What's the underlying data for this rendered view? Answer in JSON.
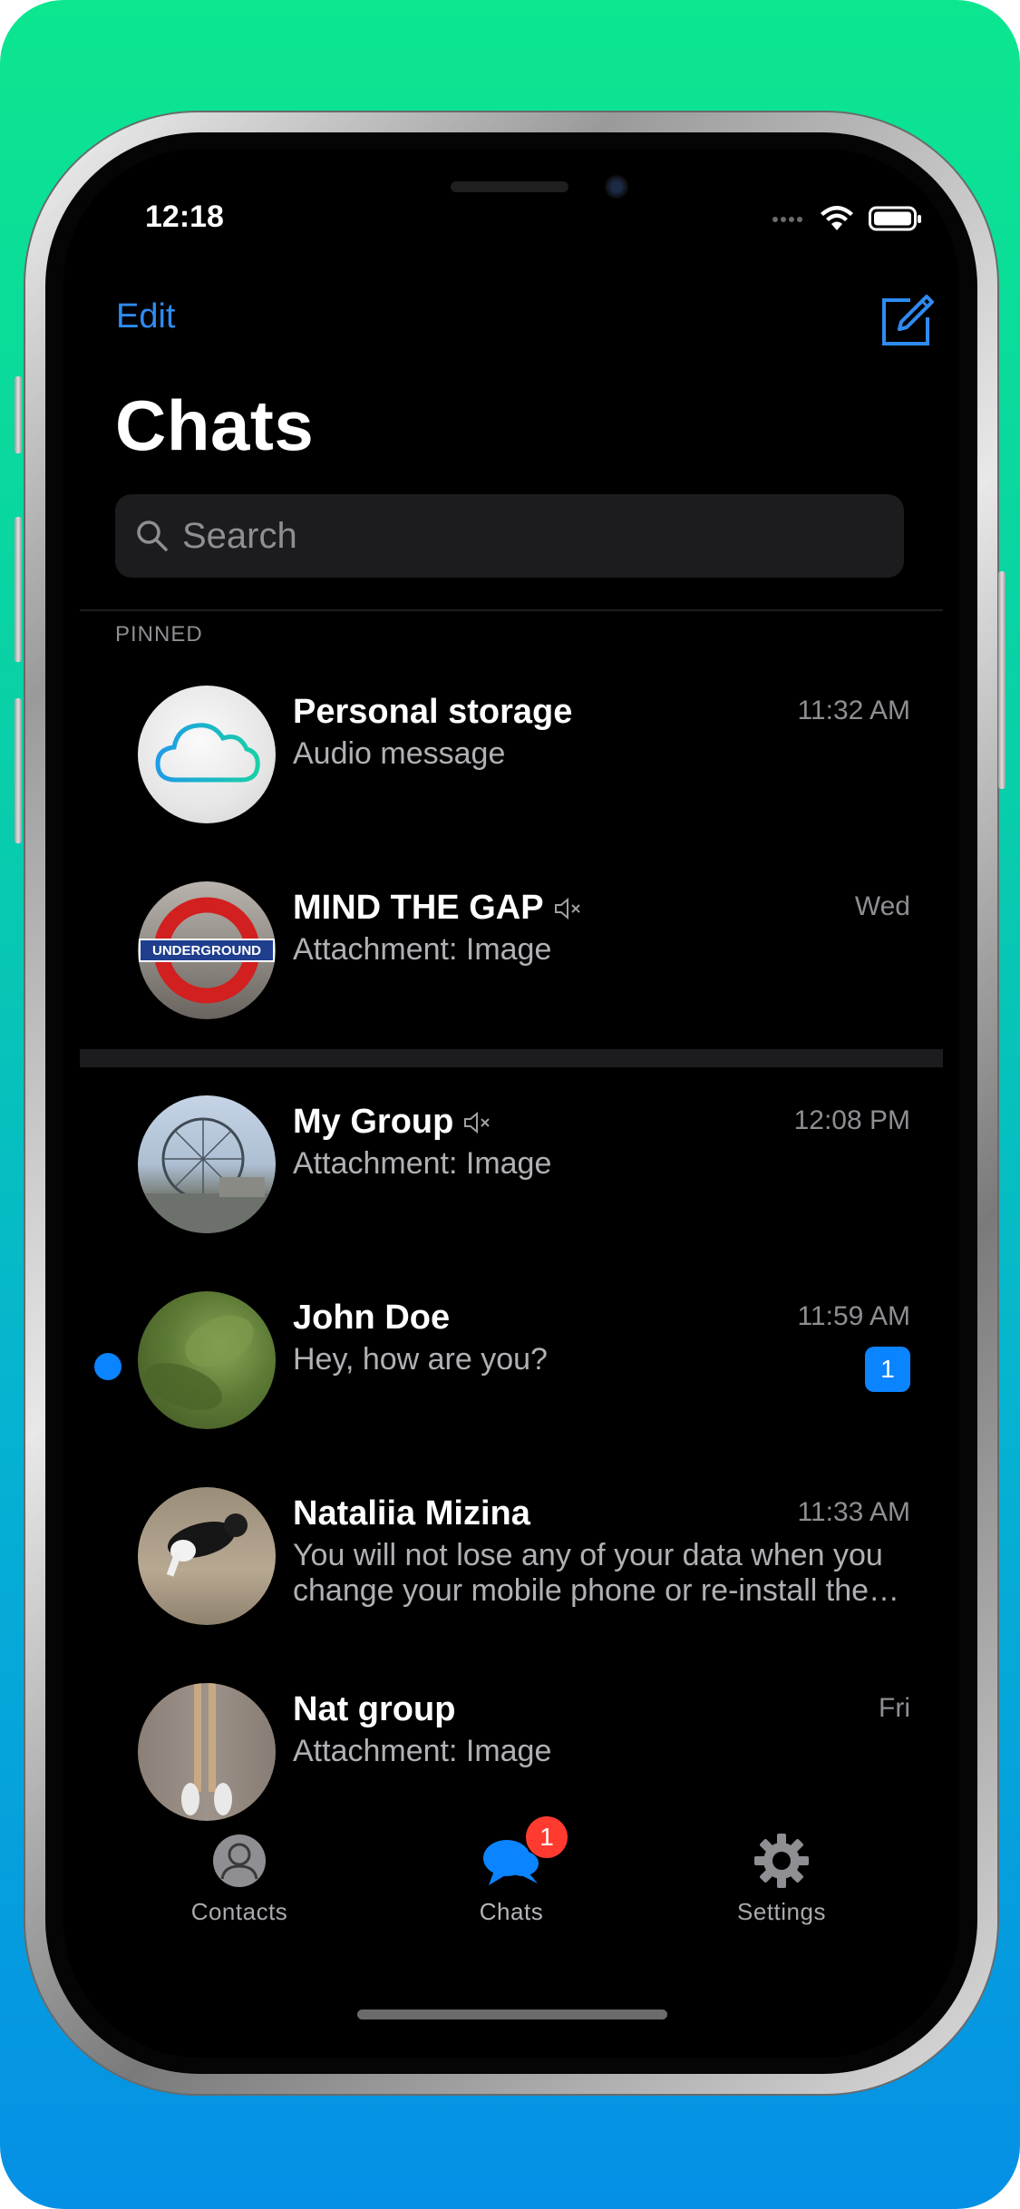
{
  "status": {
    "time": "12:18"
  },
  "header": {
    "edit_label": "Edit",
    "title": "Chats",
    "compose_icon": "compose-icon"
  },
  "search": {
    "placeholder": "Search"
  },
  "sections": {
    "pinned_label": "PINNED"
  },
  "pinned_chats": [
    {
      "name": "Personal storage",
      "message": "Audio message",
      "time": "11:32 AM",
      "muted": false,
      "avatar": "cloud-icon"
    },
    {
      "name": "MIND THE GAP",
      "message": "Attachment: Image",
      "time": "Wed",
      "muted": true,
      "avatar": "underground-roundel"
    }
  ],
  "chats": [
    {
      "name": "My Group",
      "message": "Attachment: Image",
      "time": "12:08 PM",
      "muted": true,
      "avatar": "ferris-wheel-photo"
    },
    {
      "name": "John Doe",
      "message": "Hey, how are you?",
      "time": "11:59 AM",
      "unread": true,
      "unread_count": "1",
      "avatar": "leaf-photo"
    },
    {
      "name": "Nataliia Mizina",
      "message": "You will not lose any of your data when you change your mobile phone or re-install the app",
      "time": "11:33 AM",
      "avatar": "cat-photo"
    },
    {
      "name": "Nat group",
      "message": "Attachment: Image",
      "time": "Fri",
      "avatar": "shoes-photo"
    }
  ],
  "tabbar": {
    "tabs": [
      {
        "label": "Contacts",
        "icon": "person-icon",
        "active": false
      },
      {
        "label": "Chats",
        "icon": "chat-bubbles-icon",
        "active": true,
        "badge": "1"
      },
      {
        "label": "Settings",
        "icon": "gear-icon",
        "active": false
      }
    ]
  },
  "colors": {
    "accent": "#0B84FF",
    "badge_red": "#FF3B30",
    "background": "#000000",
    "gradient_top": "#0CE68F",
    "gradient_bottom": "#0590E6"
  }
}
